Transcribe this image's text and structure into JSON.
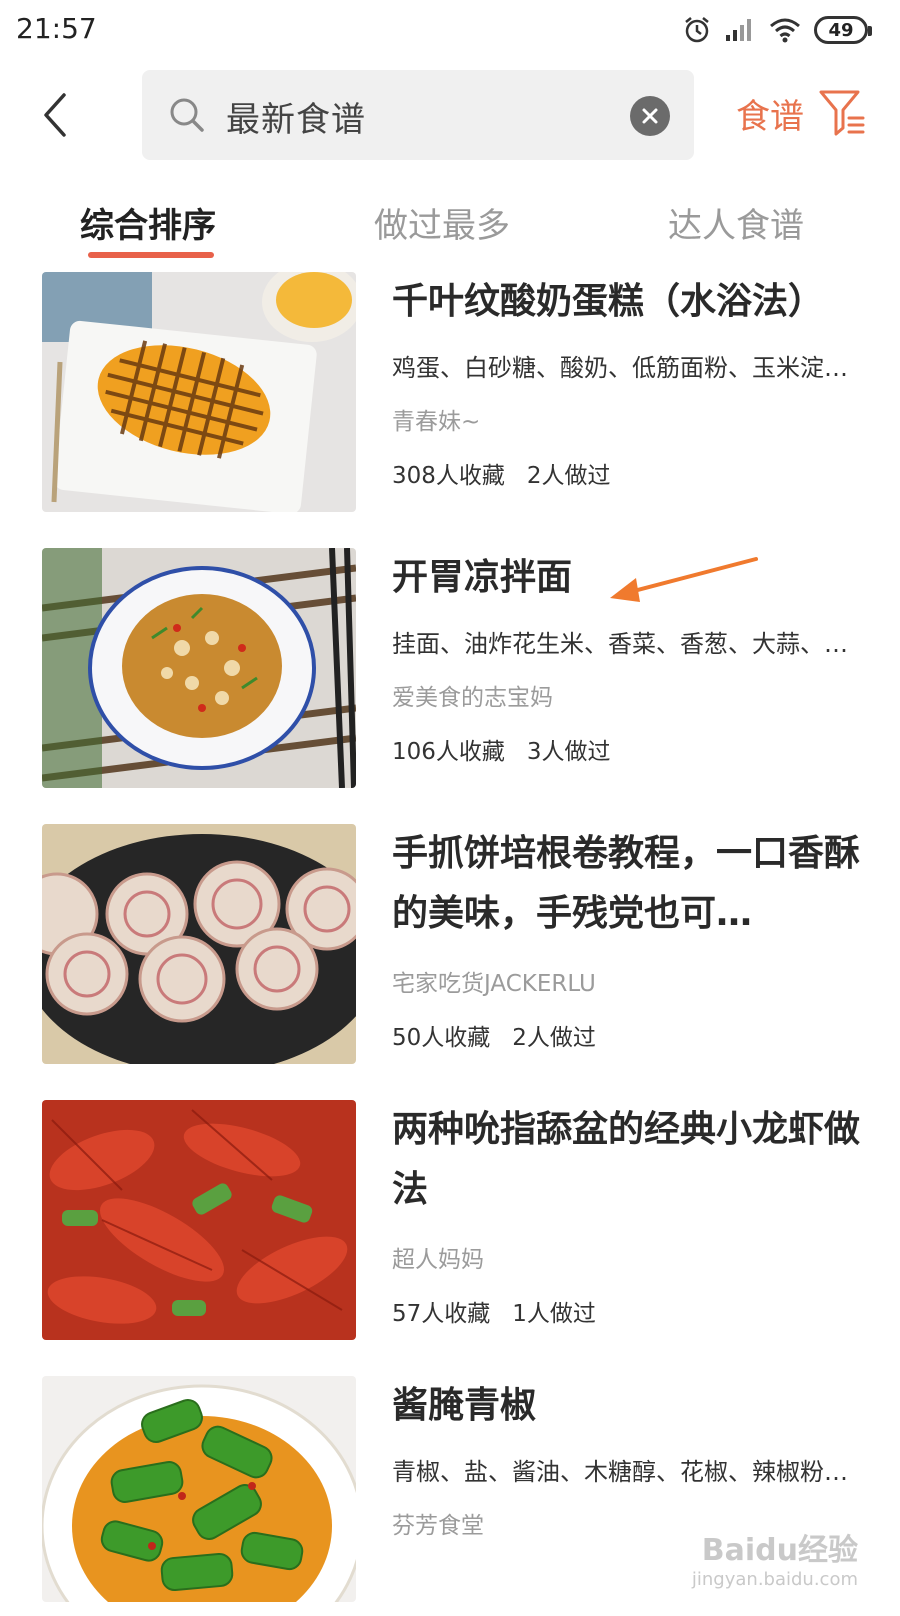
{
  "status": {
    "time": "21:57",
    "battery": "49"
  },
  "search": {
    "query": "最新食谱",
    "filter_label": "食谱"
  },
  "tabs": [
    {
      "label": "综合排序"
    },
    {
      "label": "做过最多"
    },
    {
      "label": "达人食谱"
    }
  ],
  "recipes": [
    {
      "title": "千叶纹酸奶蛋糕（水浴法）",
      "ingredients": "鸡蛋、白砂糖、酸奶、低筋面粉、玉米淀…",
      "author": "青春妹~",
      "saves": "308人收藏",
      "made": "2人做过"
    },
    {
      "title": "开胃凉拌面",
      "ingredients": "挂面、油炸花生米、香菜、香葱、大蒜、…",
      "author": "爱美食的志宝妈",
      "saves": "106人收藏",
      "made": "3人做过"
    },
    {
      "title": "手抓饼培根卷教程，一口香酥的美味，手残党也可…",
      "ingredients": "",
      "author": "宅家吃货JACKERLU",
      "saves": "50人收藏",
      "made": "2人做过"
    },
    {
      "title": "两种吮指舔盆的经典小龙虾做法",
      "ingredients": "",
      "author": "超人妈妈",
      "saves": "57人收藏",
      "made": "1人做过"
    },
    {
      "title": "酱腌青椒",
      "ingredients": "青椒、盐、酱油、木糖醇、花椒、辣椒粉…",
      "author": "芬芳食堂",
      "saves": "",
      "made": ""
    }
  ],
  "watermark": {
    "brand": "Baidu经验",
    "url": "jingyan.baidu.com"
  },
  "colors": {
    "accent": "#e8734d",
    "tab_indicator": "#e8614a",
    "arrow": "#f07a2e"
  }
}
